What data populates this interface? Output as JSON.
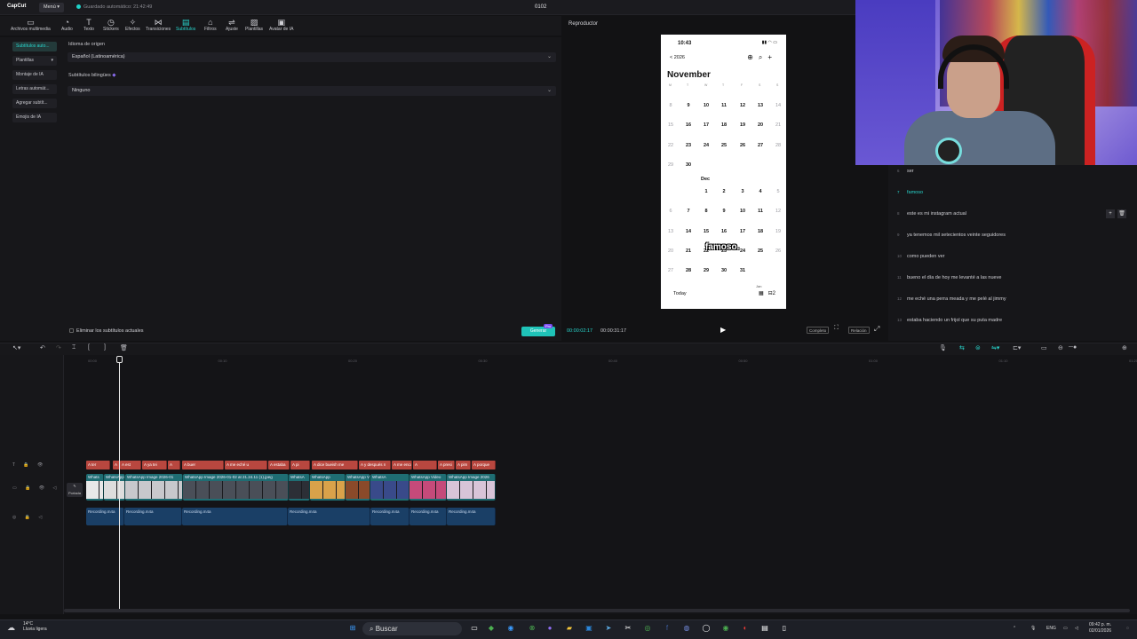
{
  "titlebar": {
    "logo": "CapCut",
    "menu": "Menú ▾",
    "autosave": "Guardado automático: 21:42:49",
    "project": "0102"
  },
  "toolbar": {
    "tools": [
      {
        "label": "Archivos multimedia",
        "icon": "media-icon"
      },
      {
        "label": "Audio",
        "icon": "audio-icon"
      },
      {
        "label": "Texto",
        "icon": "text-icon"
      },
      {
        "label": "Stickers",
        "icon": "sticker-icon"
      },
      {
        "label": "Efectos",
        "icon": "effects-icon"
      },
      {
        "label": "Transiciones",
        "icon": "transition-icon"
      },
      {
        "label": "Subtítulos",
        "icon": "subtitle-icon"
      },
      {
        "label": "Filtros",
        "icon": "filter-icon"
      },
      {
        "label": "Ajuste",
        "icon": "adjust-icon"
      },
      {
        "label": "Plantillas",
        "icon": "template-icon"
      },
      {
        "label": "Avatar de IA",
        "icon": "avatar-icon"
      }
    ],
    "active_index": 6
  },
  "sidebar": {
    "items": [
      {
        "label": "Subtítulos auto..."
      },
      {
        "label": "Plantillas"
      },
      {
        "label": "Montaje de IA"
      },
      {
        "label": "Letras automát..."
      },
      {
        "label": "Agregar subtít..."
      },
      {
        "label": "Emojis de IA"
      }
    ]
  },
  "subtitles_panel": {
    "source_lang_label": "Idioma de origen",
    "source_lang_value": "Español (Latinoamérica)",
    "bilingual_label": "Subtítulos bilingües",
    "bilingual_value": "Ninguno",
    "remove_current": "Eliminar los subtítulos actuales",
    "generate": "Generar",
    "pro_badge": "Pro"
  },
  "player": {
    "title": "Reproductor",
    "current_time": "00:00:02:17",
    "total_time": "00:00:31:17",
    "buttons": [
      "Completo",
      "Relación"
    ],
    "caption": "famoso."
  },
  "phone": {
    "time": "10:43",
    "year": "< 2026",
    "month": "November",
    "dec_label": "Dec",
    "jan_label": "Jan",
    "today": "Today",
    "inbox_count": "2",
    "weekdays": [
      "M",
      "T",
      "W",
      "T",
      "F",
      "S",
      "S"
    ],
    "nov_rows": [
      [
        "8",
        "9",
        "10",
        "11",
        "12",
        "13",
        "14"
      ],
      [
        "15",
        "16",
        "17",
        "18",
        "19",
        "20",
        "21"
      ],
      [
        "22",
        "23",
        "24",
        "25",
        "26",
        "27",
        "28"
      ],
      [
        "29",
        "30",
        "",
        "",
        "",
        "",
        ""
      ]
    ],
    "dec_rows": [
      [
        "",
        "",
        "1",
        "2",
        "3",
        "4",
        "5"
      ],
      [
        "6",
        "7",
        "8",
        "9",
        "10",
        "11",
        "12"
      ],
      [
        "13",
        "14",
        "15",
        "16",
        "17",
        "18",
        "19"
      ],
      [
        "20",
        "21",
        "22",
        "23",
        "24",
        "25",
        "26"
      ],
      [
        "27",
        "28",
        "29",
        "30",
        "31",
        "",
        ""
      ]
    ]
  },
  "subtitle_list": {
    "rows": [
      {
        "num": "6",
        "text": "ser"
      },
      {
        "num": "7",
        "text": "famoso"
      },
      {
        "num": "8",
        "text": "este es mi instagram actual"
      },
      {
        "num": "9",
        "text": "ya tenemos mil setecientos veinte seguidores"
      },
      {
        "num": "10",
        "text": "como pueden ver"
      },
      {
        "num": "11",
        "text": "bueno el día de hoy me levanté a las nueve"
      },
      {
        "num": "12",
        "text": "me eché una perra meada y me pelé al jimmy"
      },
      {
        "num": "13",
        "text": "estaba haciendo un frijol que su puta madre"
      }
    ],
    "active_index": 1
  },
  "timeline": {
    "ruler": [
      "00:00",
      "00:10",
      "00:20",
      "00:30",
      "00:40",
      "00:50",
      "01:00",
      "01:10",
      "01:20"
    ],
    "cover_label": "Portada",
    "text_clips": [
      {
        "label": "A ter"
      },
      {
        "label": "A"
      },
      {
        "label": "A est"
      },
      {
        "label": "A ya tei"
      },
      {
        "label": "A"
      },
      {
        "label": "A buer"
      },
      {
        "label": "A me eché u"
      },
      {
        "label": "A estaba"
      },
      {
        "label": "A pi"
      },
      {
        "label": "A dice bueish me"
      },
      {
        "label": "A y después n"
      },
      {
        "label": "A me encon"
      },
      {
        "label": "A"
      },
      {
        "label": "A presi"
      },
      {
        "label": "A pim"
      },
      {
        "label": "A porque"
      }
    ],
    "video_clips": [
      {
        "label": "Whats"
      },
      {
        "label": "WhatsApp"
      },
      {
        "label": "WhatsApp Image 2026-01"
      },
      {
        "label": "WhatsApp Image 2026-01-02 at 21.24.11 (1).jpeg"
      },
      {
        "label": "WhatsA"
      },
      {
        "label": "WhatsApp"
      },
      {
        "label": "WhatsApp Vide"
      },
      {
        "label": "WhatsA"
      },
      {
        "label": "WhatsApp Video"
      },
      {
        "label": "WhatsApp Image 2026"
      }
    ],
    "audio_clips": [
      {
        "label": "Recording.m4a"
      },
      {
        "label": "Recording.m4a"
      },
      {
        "label": "Recording.m4a"
      },
      {
        "label": "Recording.m4a"
      },
      {
        "label": "Recording.m4a"
      },
      {
        "label": "Recording.m4a"
      },
      {
        "label": "Recording.m4a"
      }
    ]
  },
  "taskbar": {
    "temp": "14°C",
    "weather": "Lluvia ligera",
    "search": "Buscar",
    "lang": "ENG",
    "time": "09:42 p. m.",
    "date": "02/01/2026"
  },
  "colors": {
    "accent": "#28d4cb",
    "text_clip": "#b8473f",
    "video_clip": "#1f6d73",
    "audio_clip": "#1a3f66"
  }
}
